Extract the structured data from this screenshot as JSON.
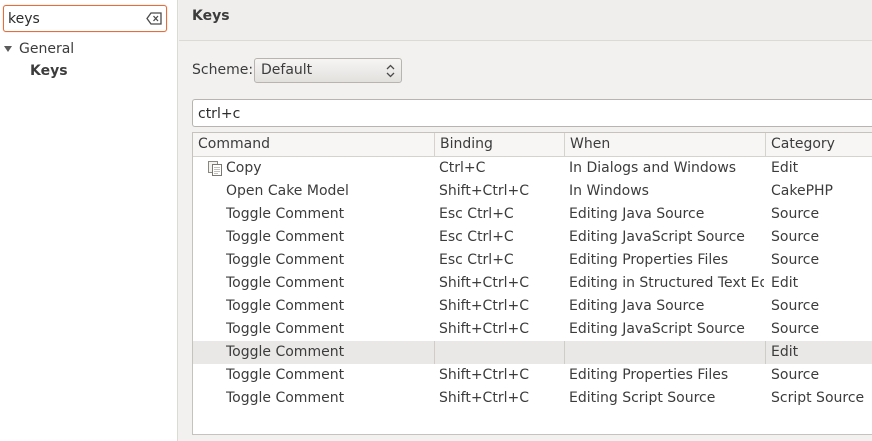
{
  "filter": {
    "value": "keys"
  },
  "tree": {
    "general": "General",
    "keys": "Keys"
  },
  "header": {
    "title": "Keys"
  },
  "scheme": {
    "label": "Scheme:",
    "value": "Default"
  },
  "binding_filter": {
    "value": "ctrl+c"
  },
  "table": {
    "columns": [
      "Command",
      "Binding",
      "When",
      "Category"
    ],
    "rows": [
      {
        "command": "Copy",
        "binding": "Ctrl+C",
        "when": "In Dialogs and Windows",
        "category": "Edit",
        "icon": "copy-icon"
      },
      {
        "command": "Open Cake Model",
        "binding": "Shift+Ctrl+C",
        "when": "In Windows",
        "category": "CakePHP"
      },
      {
        "command": "Toggle Comment",
        "binding": "Esc Ctrl+C",
        "when": "Editing Java Source",
        "category": "Source"
      },
      {
        "command": "Toggle Comment",
        "binding": "Esc Ctrl+C",
        "when": "Editing JavaScript Source",
        "category": "Source"
      },
      {
        "command": "Toggle Comment",
        "binding": "Esc Ctrl+C",
        "when": "Editing Properties Files",
        "category": "Source"
      },
      {
        "command": "Toggle Comment",
        "binding": "Shift+Ctrl+C",
        "when": "Editing in Structured Text Edit",
        "category": "Edit"
      },
      {
        "command": "Toggle Comment",
        "binding": "Shift+Ctrl+C",
        "when": "Editing Java Source",
        "category": "Source"
      },
      {
        "command": "Toggle Comment",
        "binding": "Shift+Ctrl+C",
        "when": "Editing JavaScript Source",
        "category": "Source"
      },
      {
        "command": "Toggle Comment",
        "binding": "",
        "when": "",
        "category": "Edit",
        "selected": true
      },
      {
        "command": "Toggle Comment",
        "binding": "Shift+Ctrl+C",
        "when": "Editing Properties Files",
        "category": "Source"
      },
      {
        "command": "Toggle Comment",
        "binding": "Shift+Ctrl+C",
        "when": "Editing Script Source",
        "category": "Script Source"
      }
    ]
  },
  "colors": {
    "focus_border": "#e0703e",
    "selected_row": "#e9e8e6"
  },
  "icons": {
    "clear": "clear-icon",
    "tree_expand": "tree-expanded-icon",
    "scheme_arrows": "updown-arrows-icon"
  }
}
